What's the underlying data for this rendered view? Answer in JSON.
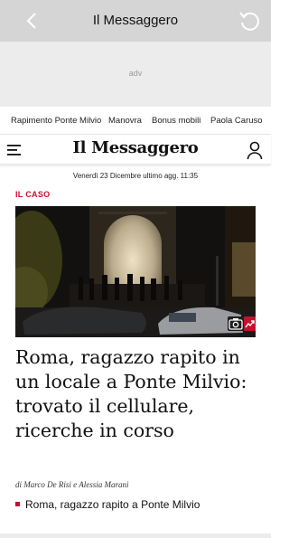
{
  "appbar": {
    "title": "Il Messaggero"
  },
  "ad": {
    "label": "adv"
  },
  "topics": [
    {
      "label": "Rapimento Ponte Milvio"
    },
    {
      "label": "Manovra"
    },
    {
      "label": "Bonus mobili"
    },
    {
      "label": "Paola Caruso"
    }
  ],
  "brand": {
    "logo": "Il Messaggero"
  },
  "dateline": "Venerdì 23 Dicembre ultimo agg. 11:35",
  "article": {
    "section": "IL CASO",
    "headline": "Roma, ragazzo rapito in un locale a Ponte Milvio: trovato il cellulare, ricerche in corso",
    "byline_prefix": "di",
    "byline_authors": "Marco De Risi e Alessia Marani",
    "related": "Roma, ragazzo rapito a Ponte Milvio"
  },
  "colors": {
    "accent": "#c8102e",
    "appbar": "#d5d5d5",
    "ad_bg": "#ececec"
  }
}
